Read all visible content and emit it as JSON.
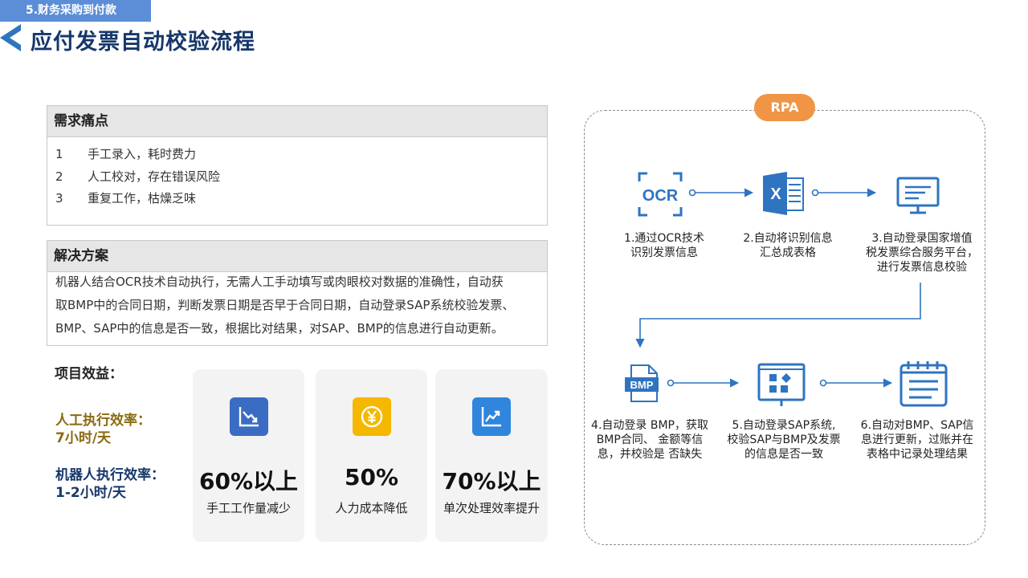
{
  "header": {
    "section_tag": "5.财务采购到付款",
    "title": "应付发票自动校验流程"
  },
  "pain_points": {
    "title": "需求痛点",
    "items": [
      {
        "num": "1",
        "text": "手工录入，耗时费力"
      },
      {
        "num": "2",
        "text": "人工校对，存在错误风险"
      },
      {
        "num": "3",
        "text": "重复工作，枯燥乏味"
      }
    ]
  },
  "solution": {
    "title": "解决方案",
    "lines": [
      "机器人结合OCR技术自动执行，无需人工手动填写或肉眼校对数据的准确性，自动获",
      "取BMP中的合同日期，判断发票日期是否早于合同日期，自动登录SAP系统校验发票、",
      "BMP、SAP中的信息是否一致，根据比对结果，对SAP、BMP的信息进行自动更新。"
    ]
  },
  "benefits": {
    "title": "项目效益：",
    "manual_efficiency": {
      "line1": "人工执行效率：",
      "line2": "7小时/天"
    },
    "robot_efficiency": {
      "line1": "机器人执行效率：",
      "line2": "1-2小时/天"
    },
    "cards": [
      {
        "value": "60%以上",
        "label": "手工工作量减少",
        "icon": "chart-down-icon",
        "color": "#3b6cc4"
      },
      {
        "value": "50%",
        "label": "人力成本降低",
        "icon": "yen-coin-icon",
        "color": "#f5b700"
      },
      {
        "value": "70%以上",
        "label": "单次处理效率提升",
        "icon": "chart-up-icon",
        "color": "#2f86dc"
      }
    ]
  },
  "rpa": {
    "badge": "RPA",
    "accent_color": "#2f74c0",
    "steps": [
      {
        "icon": "ocr-icon",
        "icon_text": "OCR",
        "lines": [
          "1.通过OCR技术",
          "识别发票信息"
        ]
      },
      {
        "icon": "excel-icon",
        "icon_text": "X",
        "lines": [
          "2.自动将识别信息",
          "汇总成表格"
        ]
      },
      {
        "icon": "monitor-icon",
        "lines": [
          "3.自动登录国家增值",
          "税发票综合服务平台，",
          "进行发票信息校验"
        ]
      },
      {
        "icon": "bmp-file-icon",
        "icon_text": "BMP",
        "lines": [
          "4.自动登录 BMP，获取",
          "BMP合同、 金额等信",
          "息，并校验是 否缺失"
        ]
      },
      {
        "icon": "app-window-icon",
        "lines": [
          "5.自动登录SAP系统,",
          "校验SAP与BMP及发票",
          "的信息是否一致"
        ]
      },
      {
        "icon": "notepad-icon",
        "lines": [
          "6.自动对BMP、SAP信",
          "息进行更新，过账并在",
          "表格中记录处理结果"
        ]
      }
    ]
  }
}
